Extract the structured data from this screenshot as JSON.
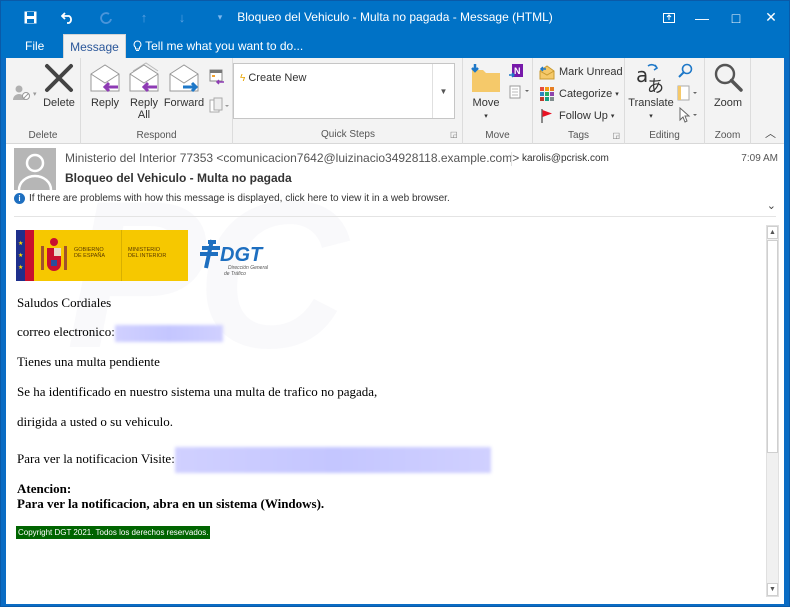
{
  "window": {
    "title": "Bloqueo del Vehiculo - Multa no pagada - Message (HTML)",
    "quick_access": [
      {
        "icon": "save-icon",
        "glyph": "💾"
      },
      {
        "icon": "undo-icon",
        "glyph": "↶"
      },
      {
        "icon": "redo-icon",
        "glyph": "↻"
      },
      {
        "icon": "up-arrow-icon",
        "glyph": "↑"
      },
      {
        "icon": "down-arrow-icon",
        "glyph": "↓"
      },
      {
        "icon": "customize-qat-icon",
        "glyph": "▾"
      }
    ],
    "controls": {
      "ribbon_display": "⊞",
      "minimize": "—",
      "maximize": "□",
      "close": "✕"
    }
  },
  "tabs": {
    "file": "File",
    "message": "Message",
    "tell_me": "Tell me what you want to do..."
  },
  "ribbon": {
    "delete_group": {
      "label": "Delete",
      "delete": "Delete"
    },
    "respond_group": {
      "label": "Respond",
      "reply": "Reply",
      "reply_all_1": "Reply",
      "reply_all_2": "All",
      "forward": "Forward"
    },
    "quick_steps": {
      "label": "Quick Steps",
      "items": [
        "Create New"
      ]
    },
    "move_group": {
      "label": "Move",
      "move": "Move"
    },
    "tags_group": {
      "label": "Tags",
      "mark_unread": "Mark Unread",
      "categorize": "Categorize",
      "follow_up": "Follow Up"
    },
    "editing_group": {
      "label": "Editing",
      "translate": "Translate"
    },
    "zoom_group": {
      "label": "Zoom",
      "zoom": "Zoom"
    }
  },
  "message": {
    "from": "Ministerio del Interior 77353 <comunicacion7642@luizinacio34928118.example.com>",
    "to": "karolis@pcrisk.com",
    "time": "7:09 AM",
    "subject": "Bloqueo del Vehiculo - Multa no pagada",
    "info_bar": "If there are problems with how this message is displayed, click here to view it in a web browser."
  },
  "body": {
    "logo_gov_line1": "GOBIERNO",
    "logo_gov_line2": "DE ESPAÑA",
    "logo_min_line1": "MINISTERIO",
    "logo_min_line2": "DEL INTERIOR",
    "dgt_name": "DGT",
    "dgt_sub1": "Dirección General",
    "dgt_sub2": "de Tráfico",
    "greeting": "Saludos Cordiales",
    "email_label": "correo electronico:",
    "line1": "Tienes una multa pendiente",
    "line2": "Se ha identificado en nuestro sistema una multa de trafico no pagada,",
    "line3": "dirigida a usted o su vehiculo.",
    "visit_label": "Para ver la notificacion Visite:",
    "attention": "Atencion:",
    "attention_text": "Para ver la notificacion, abra en un sistema (Windows).",
    "copyright": "Copyright DGT 2021. Todos los derechos reservados."
  }
}
